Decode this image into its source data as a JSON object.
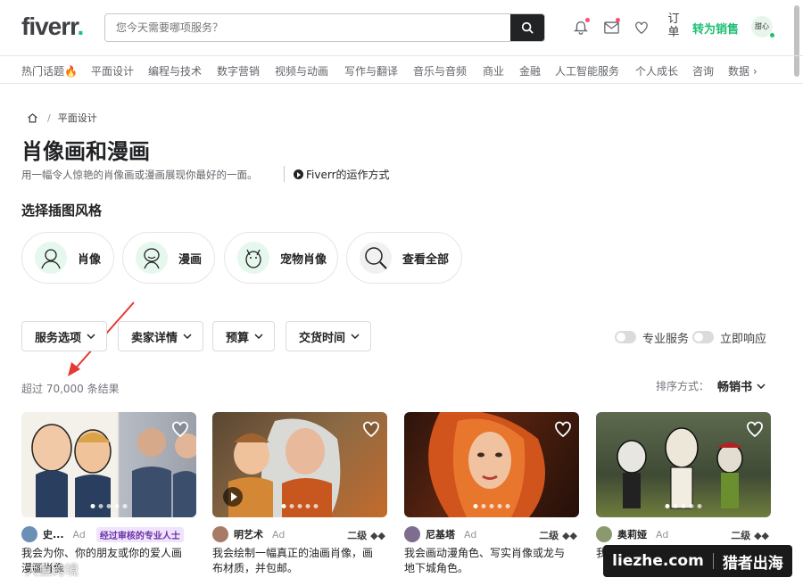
{
  "header": {
    "logo_text": "fiverr",
    "logo_dot": ".",
    "search_placeholder": "您今天需要哪项服务？",
    "orders_label": "订单",
    "become_seller": "转为销售",
    "avatar_text": "甜心"
  },
  "categories": [
    "热门话题🔥",
    "平面设计",
    "编程与技术",
    "数字营销",
    "视频与动画",
    "写作与翻译",
    "音乐与音频",
    "商业",
    "金融",
    "人工智能服务",
    "个人成长",
    "咨询",
    "数据 ›"
  ],
  "breadcrumb": {
    "current": "平面设计"
  },
  "page": {
    "title": "肖像画和漫画",
    "subtitle": "用一幅令人惊艳的肖像画或漫画展现你最好的一面。",
    "how_it_works": "Fiverr的运作方式"
  },
  "styles": {
    "title": "选择插图风格",
    "items": [
      "肖像",
      "漫画",
      "宠物肖像",
      "查看全部"
    ]
  },
  "filters": {
    "items": [
      "服务选项",
      "卖家详情",
      "预算",
      "交货时间"
    ],
    "toggles": [
      "专业服务",
      "立即响应"
    ]
  },
  "results": {
    "count_text": "超过 70,000 条结果",
    "sort_label": "排序方式：",
    "sort_value": "畅销书"
  },
  "gigs": [
    {
      "seller": "史...",
      "ad": "Ad",
      "badge": "经过审核的专业人士",
      "level": "",
      "desc1": "我会为你、你的朋友或你的爱人画",
      "desc2": "漫画肖像",
      "avatar_color": "#6b8fb5"
    },
    {
      "seller": "明艺术",
      "ad": "Ad",
      "badge": "",
      "level": "二级 ◆◆",
      "desc1": "我会绘制一幅真正的油画肖像，画",
      "desc2": "布材质，并包邮。",
      "avatar_color": "#a77b65"
    },
    {
      "seller": "尼基塔",
      "ad": "Ad",
      "badge": "",
      "level": "二级 ◆◆",
      "desc1": "我会画动漫角色、写实肖像或龙与",
      "desc2": "地下城角色。",
      "avatar_color": "#7d6e8f"
    },
    {
      "seller": "奥莉娅",
      "ad": "Ad",
      "badge": "",
      "level": "二级 ◆◆",
      "desc1": "我",
      "desc2": "",
      "avatar_color": "#8a9a6e"
    }
  ],
  "watermark": {
    "left": "大鱼跨境",
    "right_site": "liezhe.com",
    "right_brand": "猎者出海"
  }
}
